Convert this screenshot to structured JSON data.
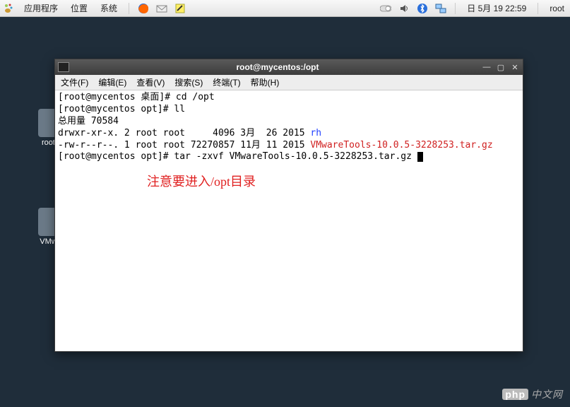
{
  "panel": {
    "apps": "应用程序",
    "places": "位置",
    "system": "系统",
    "datetime": "日 5月 19 22:59",
    "user": "root"
  },
  "desktop": {
    "icon1_label": "root…",
    "icon2_label": "VMw…"
  },
  "window": {
    "title": "root@mycentos:/opt",
    "menus": {
      "file": "文件(F)",
      "edit": "编辑(E)",
      "view": "查看(V)",
      "search": "搜索(S)",
      "terminal": "终端(T)",
      "help": "帮助(H)"
    }
  },
  "terminal": {
    "line1_prompt": "[root@mycentos 桌面]# ",
    "line1_cmd": "cd /opt",
    "line2_prompt": "[root@mycentos opt]# ",
    "line2_cmd": "ll",
    "line3": "总用量 70584",
    "line4_perm": "drwxr-xr-x. 2 root root     4096 3月  26 2015 ",
    "line4_name": "rh",
    "line5_perm": "-rw-r--r--. 1 root root 72270857 11月 11 2015 ",
    "line5_name": "VMwareTools-10.0.5-3228253.tar.gz",
    "line6_prompt": "[root@mycentos opt]# ",
    "line6_cmd": "tar -zxvf VMwareTools-10.0.5-3228253.tar.gz ",
    "annotation": "注意要进入/opt目录"
  },
  "watermark": {
    "brand": "php",
    "text": "中文网"
  }
}
